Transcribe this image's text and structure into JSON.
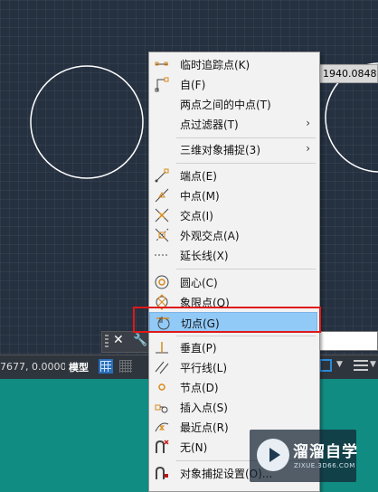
{
  "tooltip": {
    "value": "1940.0848"
  },
  "status_bar": {
    "coordinates": "7677, 0.0000",
    "model_tab": "模型"
  },
  "command_line": {
    "close_glyph": "✕",
    "tools_glyph": "🔧"
  },
  "context_menu": {
    "items": [
      {
        "label": "临时追踪点(K)",
        "icon": "temp-track-point-icon"
      },
      {
        "label": "自(F)",
        "icon": "from-icon"
      },
      {
        "label": "两点之间的中点(T)",
        "icon": ""
      },
      {
        "label": "点过滤器(T)",
        "icon": "",
        "submenu": "›"
      },
      {
        "label": "三维对象捕捉(3)",
        "icon": "",
        "submenu": "›"
      },
      {
        "label": "端点(E)",
        "icon": "endpoint-icon"
      },
      {
        "label": "中点(M)",
        "icon": "midpoint-icon"
      },
      {
        "label": "交点(I)",
        "icon": "intersection-icon"
      },
      {
        "label": "外观交点(A)",
        "icon": "apparent-intersection-icon"
      },
      {
        "label": "延长线(X)",
        "icon": "extension-icon"
      },
      {
        "label": "圆心(C)",
        "icon": "center-icon"
      },
      {
        "label": "象限点(Q)",
        "icon": "quadrant-icon"
      },
      {
        "label": "切点(G)",
        "icon": "tangent-icon",
        "highlighted": true
      },
      {
        "label": "垂直(P)",
        "icon": "perpendicular-icon"
      },
      {
        "label": "平行线(L)",
        "icon": "parallel-icon"
      },
      {
        "label": "节点(D)",
        "icon": "node-icon"
      },
      {
        "label": "插入点(S)",
        "icon": "insert-icon"
      },
      {
        "label": "最近点(R)",
        "icon": "nearest-icon"
      },
      {
        "label": "无(N)",
        "icon": "none-icon"
      },
      {
        "label": "对象捕捉设置(O)...",
        "icon": "osnap-settings-icon"
      }
    ]
  },
  "watermark": {
    "title": "溜溜自学",
    "subtitle": "ZIXUE.3D66.COM"
  },
  "colors": {
    "canvas": "#253040",
    "menu_bg": "#f2f2f2",
    "highlight": "#91c9f7",
    "annotation_box": "#e01818",
    "teal_panel": "#118c82",
    "snap_orange": "#d98a1a"
  }
}
